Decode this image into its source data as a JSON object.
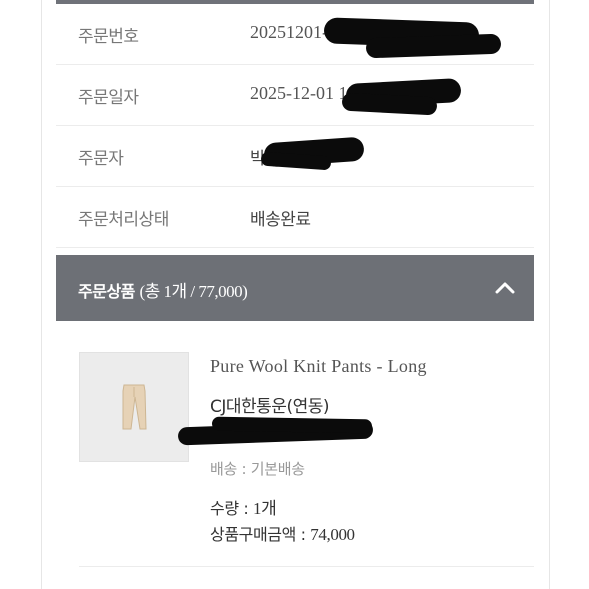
{
  "order_info": [
    {
      "label": "주문번호",
      "value": "20251201-00"
    },
    {
      "label": "주문일자",
      "value": "2025-12-01 1"
    },
    {
      "label": "주문자",
      "value": "박"
    },
    {
      "label": "주문처리상태",
      "value": "배송완료"
    }
  ],
  "products_section": {
    "title": "주문상품",
    "meta": "(총 1개 / 77,000)",
    "toggle_icon": "chevron-up-icon"
  },
  "product": {
    "image_icon": "pants-thumbnail",
    "name": "Pure Wool Knit Pants - Long",
    "courier": "CJ대한통운(연동)",
    "shipping_label": "배송 : 기본배송",
    "quantity_label": "수량 : ",
    "quantity_value": "1개",
    "price_label": "상품구매금액 : ",
    "price_value": "74,000"
  },
  "colors": {
    "section_bar": "#6d7076",
    "redaction": "#0b0b0b"
  }
}
